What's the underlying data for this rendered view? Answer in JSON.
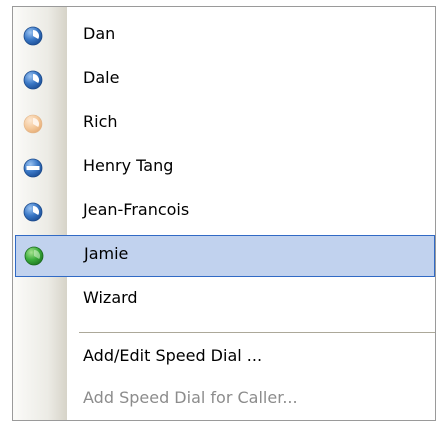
{
  "menu": {
    "items": [
      {
        "label": "Dan",
        "icon": "presence-available-icon",
        "status_color": "#3a78c6"
      },
      {
        "label": "Dale",
        "icon": "presence-available-icon",
        "status_color": "#3a78c6"
      },
      {
        "label": "Rich",
        "icon": "presence-away-icon",
        "status_color": "#f4c89a"
      },
      {
        "label": "Henry Tang",
        "icon": "presence-do-not-disturb-icon",
        "status_color": "#3a78c6"
      },
      {
        "label": "Jean-Francois",
        "icon": "presence-available-icon",
        "status_color": "#3a78c6"
      },
      {
        "label": "Jamie",
        "icon": "presence-online-icon",
        "status_color": "#3cae3c",
        "highlighted": true
      },
      {
        "label": "Wizard"
      }
    ],
    "actions": {
      "add_edit_label": "Add/Edit Speed Dial ...",
      "add_for_caller_label": "Add Speed Dial for Caller...",
      "add_for_caller_disabled": true
    },
    "colors": {
      "highlight_bg": "#c1d2ee",
      "highlight_border": "#316ac5",
      "disabled_text": "#8c8c8c"
    }
  }
}
